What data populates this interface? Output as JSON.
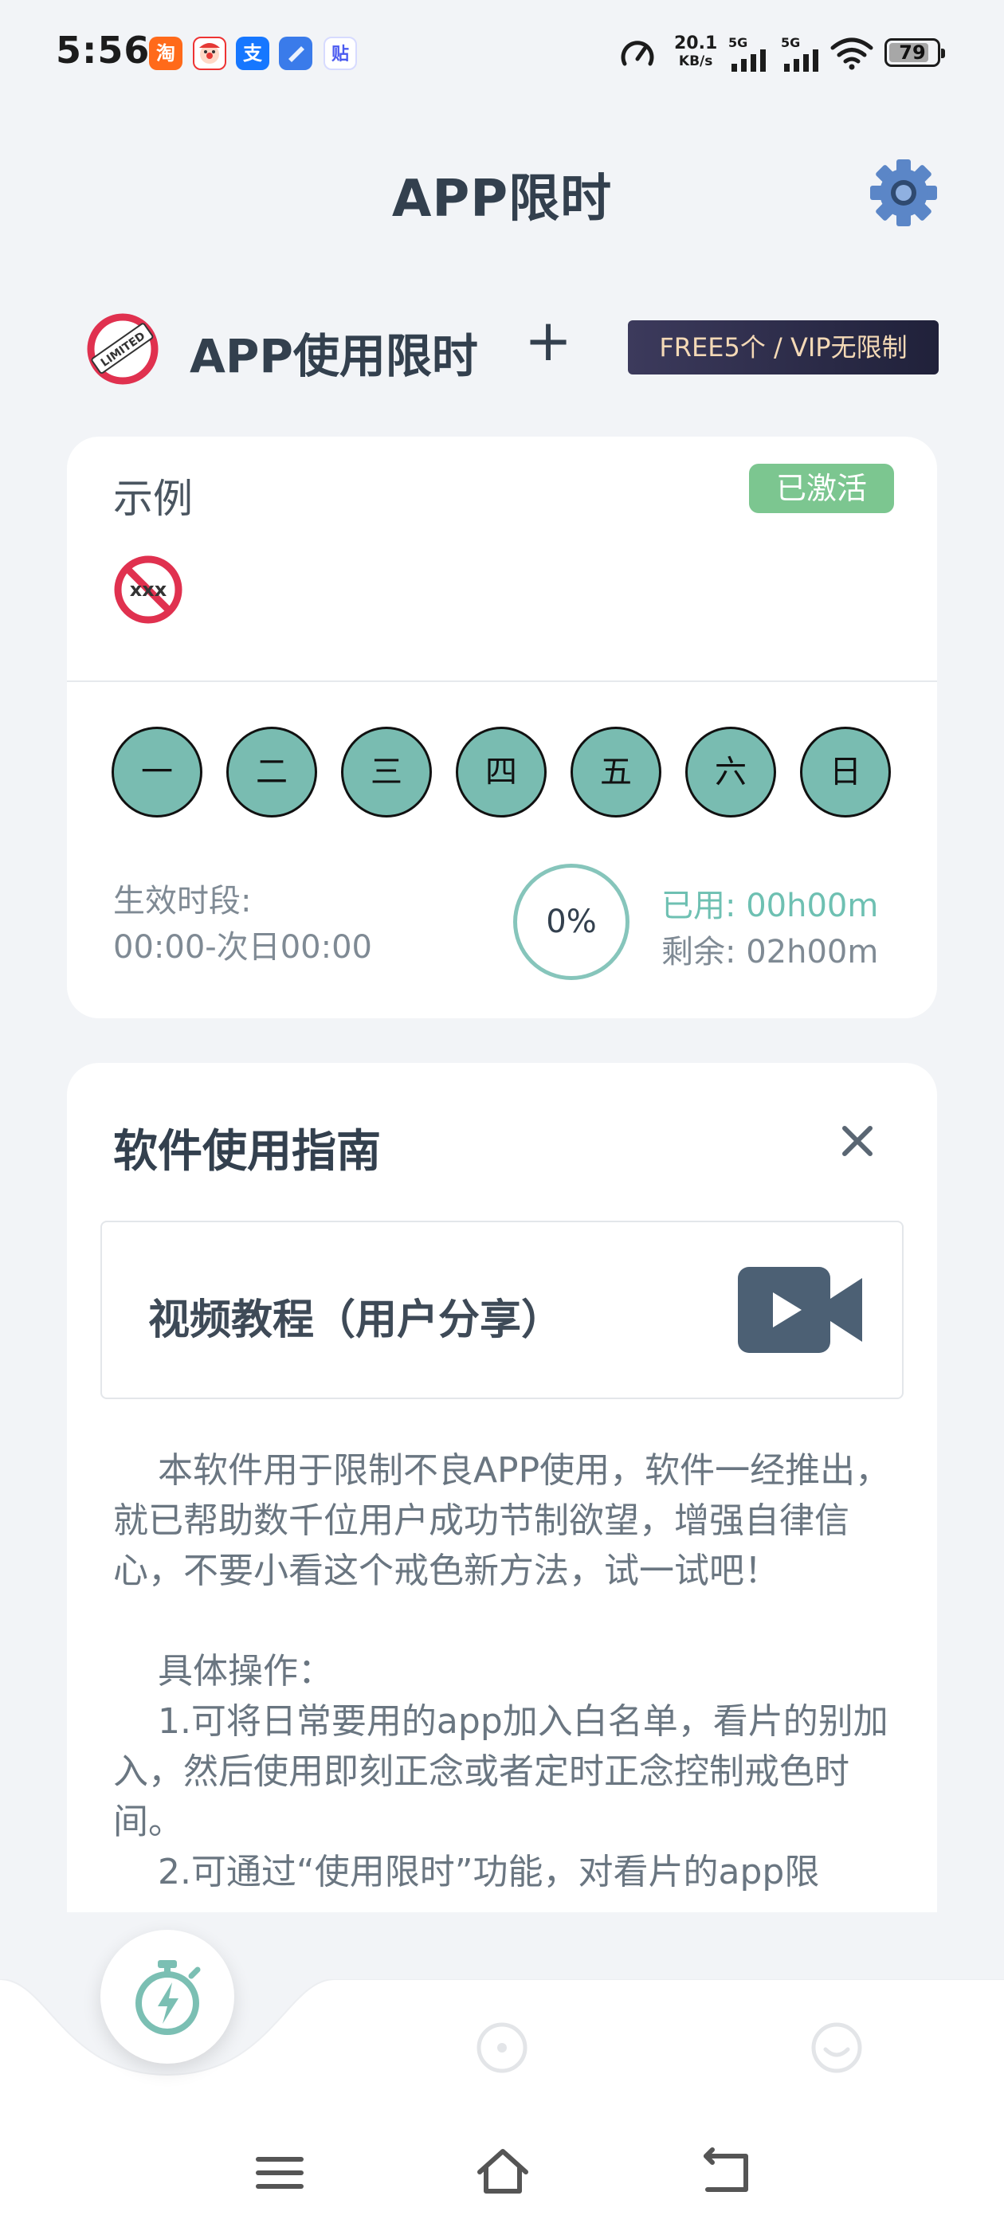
{
  "status_bar": {
    "time": "5:56",
    "net_speed_value": "20.1",
    "net_speed_unit": "KB/s",
    "signal_1_label": "5G",
    "signal_2_label": "5G",
    "battery_level": "79",
    "notification_icons": [
      "taobao-icon",
      "clown-game-icon",
      "alipay-icon",
      "blue-app-icon",
      "tieba-icon"
    ],
    "notification_glyphs": [
      "淘",
      "",
      "支",
      "",
      "贴"
    ]
  },
  "header": {
    "title": "APP限时"
  },
  "limit_section": {
    "title": "APP使用限时",
    "add_symbol": "+",
    "plan_badge": "FREE5个 / VIP无限制",
    "logo_text": "LIMITED"
  },
  "example_card": {
    "label": "示例",
    "status": "已激活",
    "blocked_icon_text": "xxx",
    "days": [
      "一",
      "二",
      "三",
      "四",
      "五",
      "六",
      "日"
    ],
    "period_label": "生效时段:",
    "period_value": "00:00-次日00:00",
    "progress": "0%",
    "progress_fraction": 0,
    "used": "已用: 00h00m",
    "remaining": "剩余: 02h00m"
  },
  "guide": {
    "title": "软件使用指南",
    "video_label": "视频教程（用户分享）",
    "text": "    本软件用于限制不良APP使用，软件一经推出，就已帮助数千位用户成功节制欲望，增强自律信心，不要小看这个戒色新方法，试一试吧！\n\n    具体操作：\n    1.可将日常要用的app加入白名单，看片的别加入，然后使用即刻正念或者定时正念控制戒色时间。\n    2.可通过“使用限时”功能，对看片的app限"
  },
  "colors": {
    "accent_teal": "#79bcb1",
    "active_green": "#7cc690",
    "settings_blue": "#5b86c7",
    "text_dark": "#33404e"
  },
  "bottom_nav": {
    "tabs": [
      "timer-icon",
      "focus-icon",
      "smile-icon"
    ]
  }
}
